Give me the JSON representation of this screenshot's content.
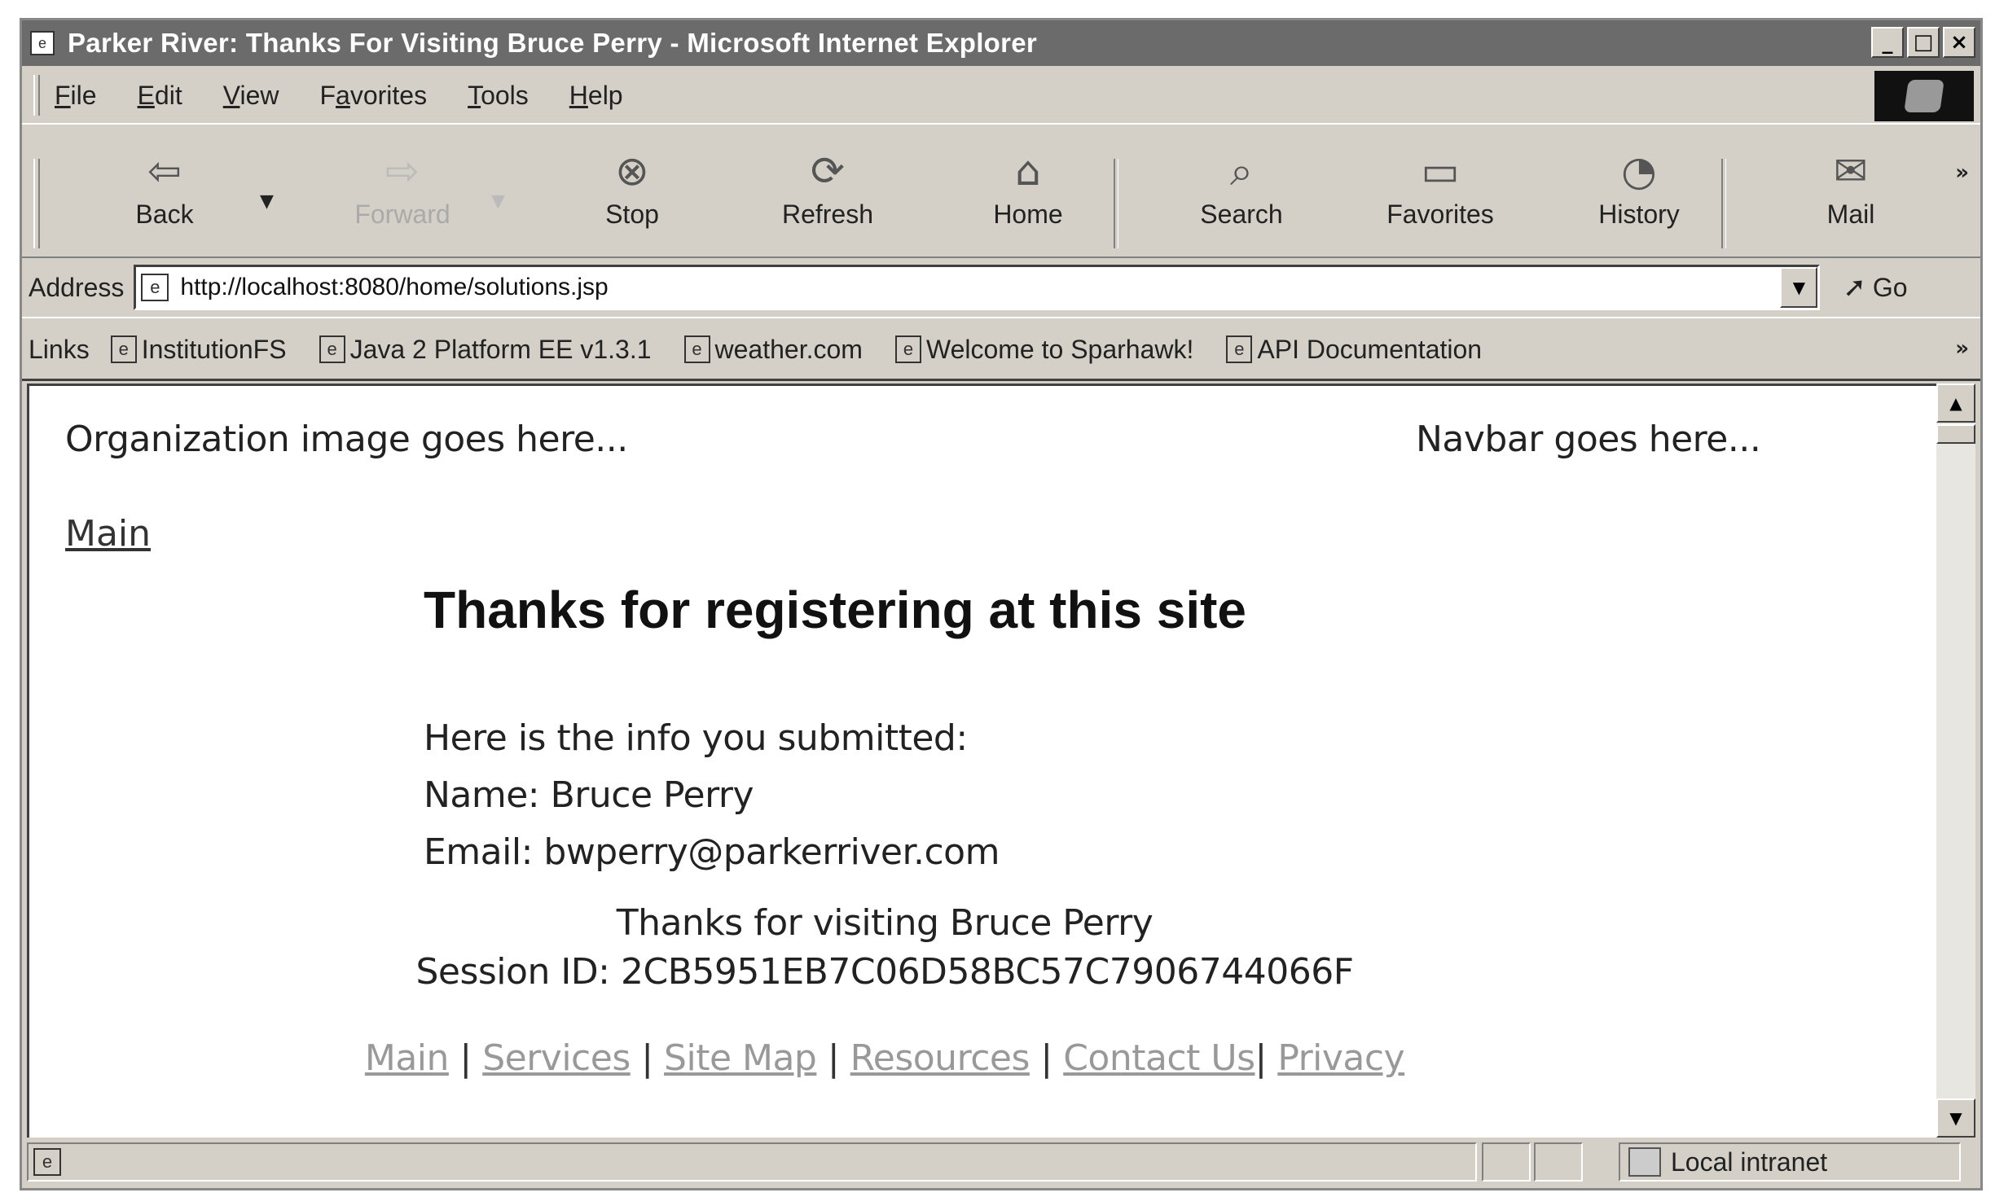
{
  "window": {
    "title": "Parker River: Thanks For Visiting Bruce Perry - Microsoft Internet Explorer",
    "controls": {
      "minimize": "_",
      "maximize": "□",
      "close": "×"
    }
  },
  "menubar": {
    "items": [
      {
        "pre": "",
        "key": "F",
        "post": "ile"
      },
      {
        "pre": "",
        "key": "E",
        "post": "dit"
      },
      {
        "pre": "",
        "key": "V",
        "post": "iew"
      },
      {
        "pre": "F",
        "key": "a",
        "post": "vorites"
      },
      {
        "pre": "",
        "key": "T",
        "post": "ools"
      },
      {
        "pre": "",
        "key": "H",
        "post": "elp"
      }
    ]
  },
  "toolbar": {
    "back": "Back",
    "forward": "Forward",
    "stop": "Stop",
    "refresh": "Refresh",
    "home": "Home",
    "search": "Search",
    "favorites": "Favorites",
    "history": "History",
    "mail": "Mail",
    "more": "»"
  },
  "address": {
    "label": "Address",
    "url": "http://localhost:8080/home/solutions.jsp",
    "go": "Go"
  },
  "links": {
    "label": "Links",
    "items": [
      "InstitutionFS",
      "Java 2 Platform EE v1.3.1",
      "weather.com",
      "Welcome to Sparhawk!",
      "API Documentation"
    ],
    "more": "»"
  },
  "page": {
    "org_placeholder": "Organization image goes here...",
    "navbar_placeholder": "Navbar goes here...",
    "main_link": "Main",
    "heading": "Thanks for registering at this site",
    "info_intro": "Here is the info you submitted:",
    "name_line": "Name: Bruce Perry",
    "email_line": "Email: bwperry@parkerriver.com",
    "thanks_line": "Thanks for visiting Bruce Perry",
    "session_line": "Session ID: 2CB5951EB7C06D58BC57C7906744066F",
    "footer_links": [
      "Main",
      "Services",
      "Site Map",
      "Resources",
      "Contact Us",
      "Privacy"
    ]
  },
  "status": {
    "zone": "Local intranet"
  }
}
